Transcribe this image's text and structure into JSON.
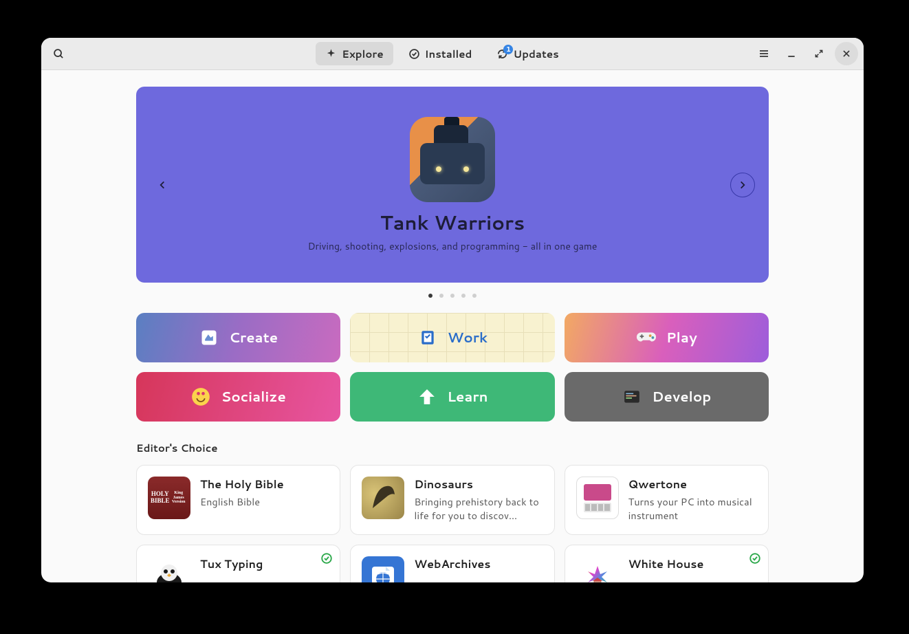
{
  "header": {
    "tabs": [
      {
        "id": "explore",
        "label": "Explore",
        "active": true
      },
      {
        "id": "installed",
        "label": "Installed",
        "active": false
      },
      {
        "id": "updates",
        "label": "Updates",
        "active": false,
        "badge": "1"
      }
    ]
  },
  "hero": {
    "title": "Tank Warriors",
    "subtitle": "Driving, shooting, explosions, and programming - all in one game",
    "page_count": 5,
    "active_page": 0
  },
  "categories": [
    {
      "id": "create",
      "label": "Create"
    },
    {
      "id": "work",
      "label": "Work"
    },
    {
      "id": "play",
      "label": "Play"
    },
    {
      "id": "socialize",
      "label": "Socialize"
    },
    {
      "id": "learn",
      "label": "Learn"
    },
    {
      "id": "develop",
      "label": "Develop"
    }
  ],
  "section_title": "Editor's Choice",
  "apps": [
    {
      "name": "The Holy Bible",
      "desc": "English Bible",
      "installed": false
    },
    {
      "name": "Dinosaurs",
      "desc": "Bringing prehistory back to life for you to discov…",
      "installed": false
    },
    {
      "name": "Qwertone",
      "desc": "Turns your PC into musical instrument",
      "installed": false
    },
    {
      "name": "Tux Typing",
      "desc": "",
      "installed": true
    },
    {
      "name": "WebArchives",
      "desc": "",
      "installed": false
    },
    {
      "name": "White House",
      "desc": "",
      "installed": true
    }
  ]
}
